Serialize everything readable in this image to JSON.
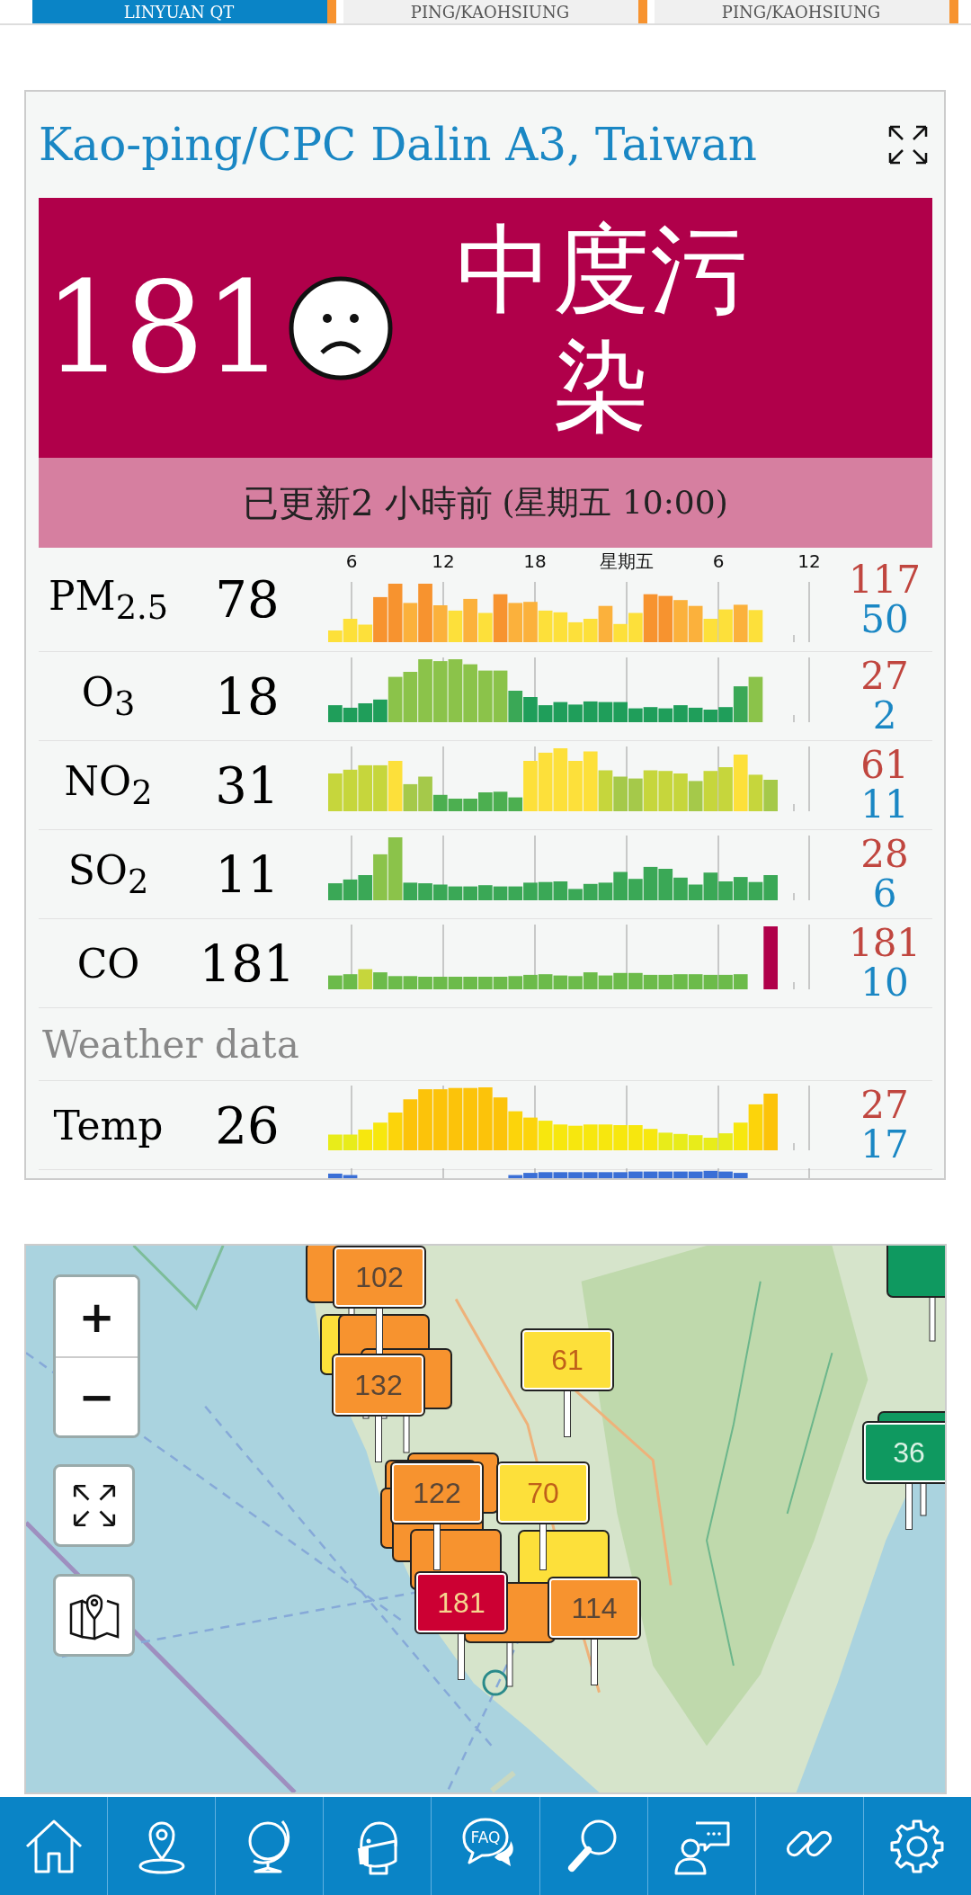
{
  "tabs": [
    {
      "label": "LINYUAN QT",
      "selected": true,
      "color": "#f7932f"
    },
    {
      "label": "PING/KAOHSIUNG",
      "selected": false,
      "color": "#f7932f"
    },
    {
      "label": "PING/KAOHSIUNG",
      "selected": false,
      "color": "#f7932f"
    }
  ],
  "station": {
    "title": "Kao-ping/CPC Dalin A3, Taiwan"
  },
  "aqi": {
    "value": "181",
    "level_text": "中度污染",
    "updated": "已更新2 小時前",
    "updated_time": "(星期五 10:00)"
  },
  "time_labels": [
    "6",
    "12",
    "18",
    "星期五",
    "6",
    "12"
  ],
  "pollutants": [
    {
      "name": "PM$_{2.5}$",
      "value": "78",
      "max": "117",
      "min": "50"
    },
    {
      "name": "O$_{3}$",
      "value": "18",
      "max": "27",
      "min": "2"
    },
    {
      "name": "NO$_{2}$",
      "value": "31",
      "max": "61",
      "min": "11"
    },
    {
      "name": "SO$_{2}$",
      "value": "11",
      "max": "28",
      "min": "6"
    },
    {
      "name": "CO",
      "value": "181",
      "max": "181",
      "min": "10"
    }
  ],
  "weather_heading": "Weather data",
  "weather": [
    {
      "name": "Temp",
      "value": "26",
      "max": "27",
      "min": "17"
    }
  ],
  "map": {
    "zoom_in": "+",
    "zoom_out": "−",
    "markers": [
      {
        "color": "#f7932f"
      },
      {
        "value": "102",
        "color": "#f7932f"
      },
      {
        "color": "#fde03a"
      },
      {
        "color": "#f7932f"
      },
      {
        "color": "#f7932f"
      },
      {
        "value": "132",
        "color": "#f7932f"
      },
      {
        "value": "70",
        "color": "#fde03a"
      },
      {
        "value": "122",
        "color": "#f7932f"
      },
      {
        "color": "#f7932f"
      },
      {
        "color": "#f7932f"
      },
      {
        "color": "#f7932f"
      },
      {
        "color": "#f7932f"
      },
      {
        "color": "#f7932f"
      },
      {
        "color": "#fde03a"
      },
      {
        "value": "61",
        "color": "#fde03a"
      },
      {
        "color": "#f7932f"
      },
      {
        "value": "114",
        "color": "#f7932f"
      },
      {
        "value": "181",
        "color": "#cc0033"
      },
      {
        "color": "#0f9960"
      },
      {
        "value": "36",
        "color": "#0f9960"
      },
      {
        "color": "#0f9960"
      }
    ]
  },
  "nav": [
    {
      "kind": "home"
    },
    {
      "kind": "pin"
    },
    {
      "kind": "globe"
    },
    {
      "kind": "mask"
    },
    {
      "kind": "faq",
      "label": "FAQ"
    },
    {
      "kind": "search"
    },
    {
      "kind": "chat"
    },
    {
      "kind": "link"
    },
    {
      "kind": "gear"
    }
  ]
}
